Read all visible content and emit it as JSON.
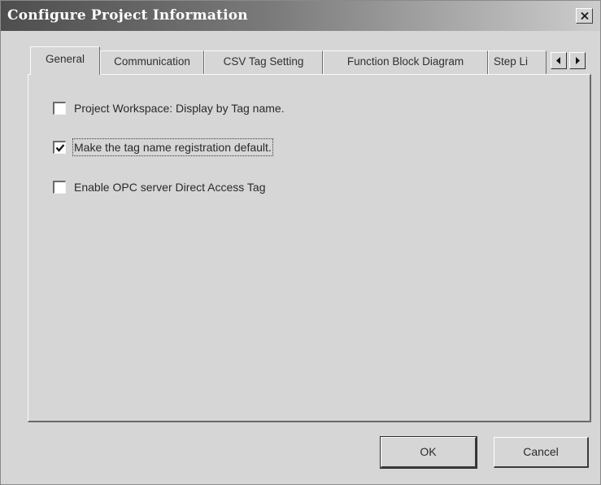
{
  "window": {
    "title": "Configure Project Information",
    "close_glyph": "x"
  },
  "tabs": [
    {
      "label": "General",
      "active": true
    },
    {
      "label": "Communication",
      "active": false
    },
    {
      "label": "CSV Tag Setting",
      "active": false
    },
    {
      "label": "Function Block Diagram",
      "active": false
    },
    {
      "label": "Step Li",
      "active": false
    }
  ],
  "tab_scroll": {
    "left_icon": "arrow-left-icon",
    "right_icon": "arrow-right-icon"
  },
  "options": [
    {
      "label": "Project Workspace: Display by Tag name.",
      "checked": false
    },
    {
      "label": "Make the tag name registration default.",
      "checked": true
    },
    {
      "label": "Enable OPC server Direct Access Tag",
      "checked": false
    }
  ],
  "buttons": {
    "ok_label": "OK",
    "cancel_label": "Cancel"
  },
  "colors": {
    "dialog_face": "#d6d6d6",
    "titlebar_start": "#4e4e4e",
    "titlebar_end": "#cdcdcd"
  }
}
